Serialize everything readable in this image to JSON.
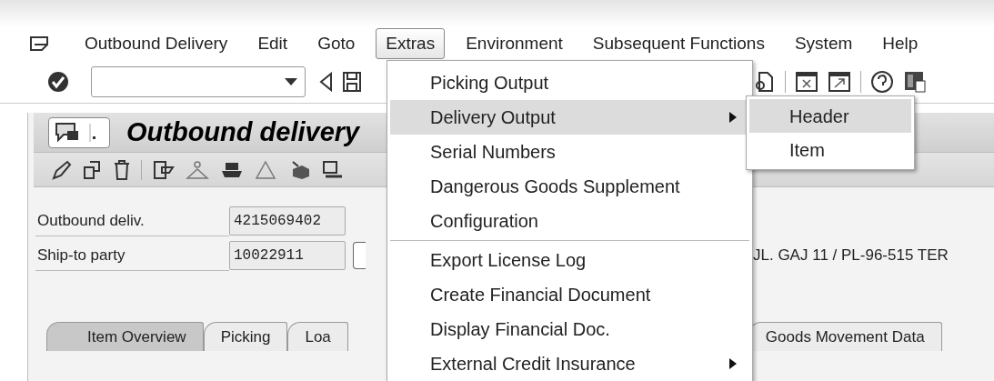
{
  "menu_bar": {
    "items": [
      {
        "label": "Outbound Delivery",
        "selected": false
      },
      {
        "label": "Edit",
        "selected": false
      },
      {
        "label": "Goto",
        "selected": false
      },
      {
        "label": "Extras",
        "selected": true
      },
      {
        "label": "Environment",
        "selected": false
      },
      {
        "label": "Subsequent Functions",
        "selected": false
      },
      {
        "label": "System",
        "selected": false
      },
      {
        "label": "Help",
        "selected": false
      }
    ]
  },
  "screen": {
    "title": "Outbound delivery",
    "fields": [
      {
        "label": "Outbound deliv.",
        "value": "4215069402"
      },
      {
        "label": "Ship-to party",
        "value": "10022911"
      }
    ],
    "address": "JL. GAJ 11 / PL-96-515 TER",
    "tabs": [
      {
        "label": "Item Overview",
        "selected": true
      },
      {
        "label": "Picking",
        "selected": false
      },
      {
        "label": "Loa",
        "selected": false
      },
      {
        "label": "Goods Movement Data",
        "selected": false
      }
    ]
  },
  "extras_menu": {
    "groups": [
      [
        {
          "label": "Picking Output",
          "selected": false,
          "submenu": false
        },
        {
          "label": "Delivery Output",
          "selected": true,
          "submenu": true
        },
        {
          "label": "Serial Numbers",
          "selected": false,
          "submenu": false
        },
        {
          "label": "Dangerous Goods Supplement",
          "selected": false,
          "submenu": false
        },
        {
          "label": "Configuration",
          "selected": false,
          "submenu": false
        }
      ],
      [
        {
          "label": "Export License Log",
          "selected": false,
          "submenu": false
        },
        {
          "label": "Create Financial Document",
          "selected": false,
          "submenu": false
        },
        {
          "label": "Display Financial Doc.",
          "selected": false,
          "submenu": false
        },
        {
          "label": "External Credit Insurance",
          "selected": false,
          "submenu": true
        }
      ]
    ]
  },
  "submenu": {
    "items": [
      {
        "label": "Header",
        "selected": true
      },
      {
        "label": "Item",
        "selected": false
      }
    ]
  }
}
